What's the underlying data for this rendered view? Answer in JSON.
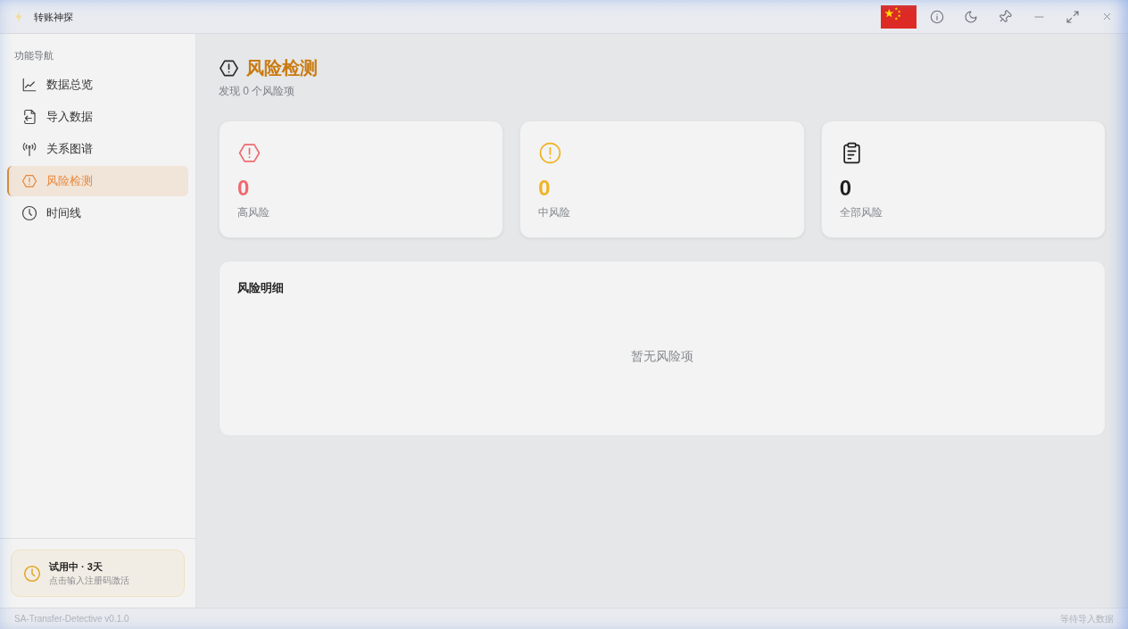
{
  "window": {
    "title": "转账神探"
  },
  "sidebar": {
    "heading": "功能导航",
    "items": [
      {
        "label": "数据总览",
        "selected": false
      },
      {
        "label": "导入数据",
        "selected": false
      },
      {
        "label": "关系图谱",
        "selected": false
      },
      {
        "label": "风险检测",
        "selected": true
      },
      {
        "label": "时间线",
        "selected": false
      }
    ],
    "trial": {
      "title": "试用中 · 3天",
      "subtitle": "点击输入注册码激活"
    }
  },
  "page": {
    "title": "风险检测",
    "subtitle": "发现 0 个风险项"
  },
  "stats": [
    {
      "value": "0",
      "label": "高风险",
      "color": "#ee6a6f"
    },
    {
      "value": "0",
      "label": "中风险",
      "color": "#f0b323"
    },
    {
      "value": "0",
      "label": "全部风险",
      "color": "#1f1f1f"
    }
  ],
  "details": {
    "title": "风险明细",
    "empty_text": "暂无风险项"
  },
  "status_bar": {
    "left": "SA-Transfer-Detective v0.1.0",
    "right": "等待导入数据"
  }
}
